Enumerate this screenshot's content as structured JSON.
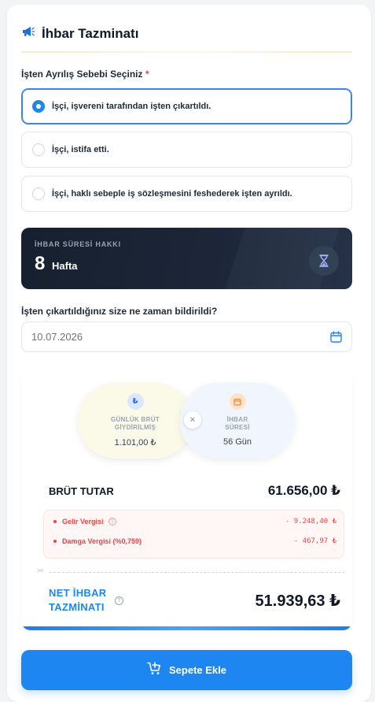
{
  "header": {
    "title": "İhbar Tazminatı",
    "icon": "megaphone-icon"
  },
  "reason": {
    "label": "İşten Ayrılış Sebebi Seçiniz",
    "required_mark": "*",
    "options": [
      {
        "label": "İşçi, işvereni tarafından işten çıkartıldı.",
        "selected": true
      },
      {
        "label": "İşçi, istifa etti.",
        "selected": false
      },
      {
        "label": "İşçi, haklı sebeple iş sözleşmesini feshederek işten ayrıldı.",
        "selected": false
      }
    ]
  },
  "notice": {
    "label": "İHBAR SÜRESİ HAKKI",
    "value": "8",
    "unit": "Hafta",
    "icon": "hourglass-icon"
  },
  "date": {
    "label": "İşten çıkartıldığınız size ne zaman bildirildi?",
    "value": "10.07.2026",
    "icon": "calendar-icon"
  },
  "calc": {
    "daily": {
      "label_line1": "GÜNLÜK BRÜT",
      "label_line2": "GİYDİRİLMİŞ",
      "value": "1.101,00 ₺",
      "icon": "lira-icon"
    },
    "multiply": "×",
    "period": {
      "label_line1": "İHBAR",
      "label_line2": "SÜRESİ",
      "value": "56 Gün",
      "icon": "calendar-icon"
    },
    "gross_label": "BRÜT TUTAR",
    "gross_value": "61.656,00 ₺",
    "taxes": [
      {
        "name": "Gelir Vergisi",
        "amount": "- 9.248,40 ₺"
      },
      {
        "name": "Damga Vergisi (%0,759)",
        "amount": "- 467,97 ₺"
      }
    ],
    "net_label_line1": "NET İHBAR",
    "net_label_line2": "TAZMİNATI",
    "net_value": "51.939,63 ₺"
  },
  "cart_button": {
    "label": "Sepete Ekle",
    "icon": "cart-plus-icon"
  },
  "colors": {
    "accent": "#1d86f0",
    "danger": "#ef4444",
    "dark_card": "#1c2638"
  }
}
